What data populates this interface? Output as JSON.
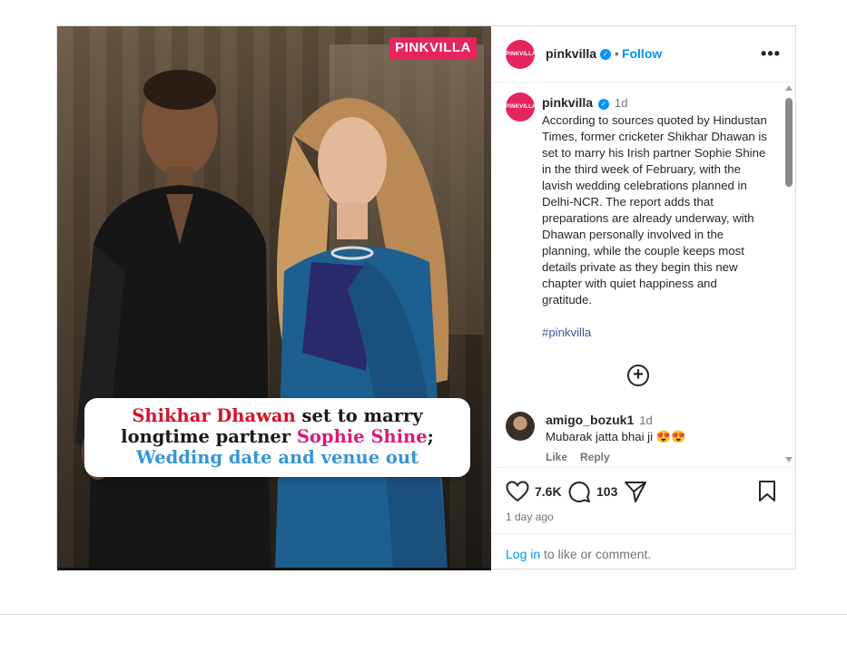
{
  "photo": {
    "brand_badge": "PINKVILLA",
    "headline_parts": {
      "red": "Shikhar Dhawan",
      "black1": " set to marry longtime partner ",
      "pink": "Sophie Shine",
      "black2": "; ",
      "blue": "Wedding date and venue out"
    }
  },
  "header": {
    "avatar_text": "PINKVILLA",
    "username": "pinkvilla",
    "verified_icon": "verified-badge-icon",
    "separator": "•",
    "follow_label": "Follow",
    "more_icon": "more-options-icon"
  },
  "caption": {
    "avatar_text": "PINKVILLA",
    "username": "pinkvilla",
    "age": "1d",
    "text": "According to sources quoted by Hindustan Times, former cricketer Shikhar Dhawan is set to marry his Irish partner Sophie Shine in the third week of February, with the lavish wedding celebrations planned in Delhi-NCR. The report adds that preparations are already underway, with Dhawan personally involved in the planning, while the couple keeps most details private as they begin this new chapter with quiet happiness and gratitude.",
    "hashtag": "#pinkvilla"
  },
  "load_more_icon": "plus-circle-icon",
  "comment": {
    "username": "amigo_bozuk1",
    "age": "1d",
    "text": "Mubarak jatta bhai ji 😍😍",
    "like_label": "Like",
    "reply_label": "Reply"
  },
  "actions": {
    "like_count": "7.6K",
    "comment_count": "103",
    "timestamp": "1 day ago",
    "login_link": "Log in",
    "login_suffix": " to like or comment."
  },
  "colors": {
    "brand": "#e5245e",
    "link": "#0095f6",
    "muted": "#737373"
  }
}
